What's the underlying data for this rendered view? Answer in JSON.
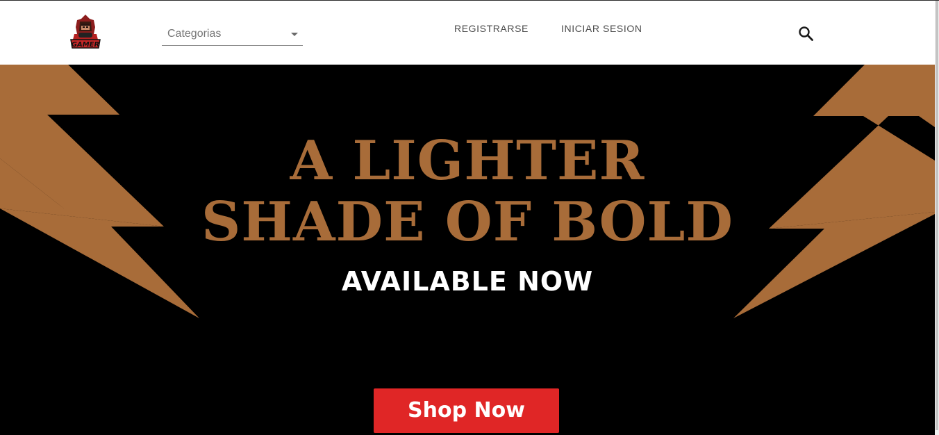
{
  "header": {
    "logo_text": "GAMER",
    "categories_select": {
      "selected": "Categorias"
    },
    "nav": {
      "register_label": "REGISTRARSE",
      "login_label": "INICIAR SESION"
    },
    "search_icon": "search-icon"
  },
  "hero": {
    "headline_line1": "A LIGHTER",
    "headline_line2": "SHADE OF BOLD",
    "subheadline": "AVAILABLE NOW",
    "cta_label": "Shop Now"
  },
  "colors": {
    "accent_copper": "#a86c39",
    "cta_red": "#e02626",
    "hero_background": "#000000",
    "header_background": "#ffffff"
  }
}
